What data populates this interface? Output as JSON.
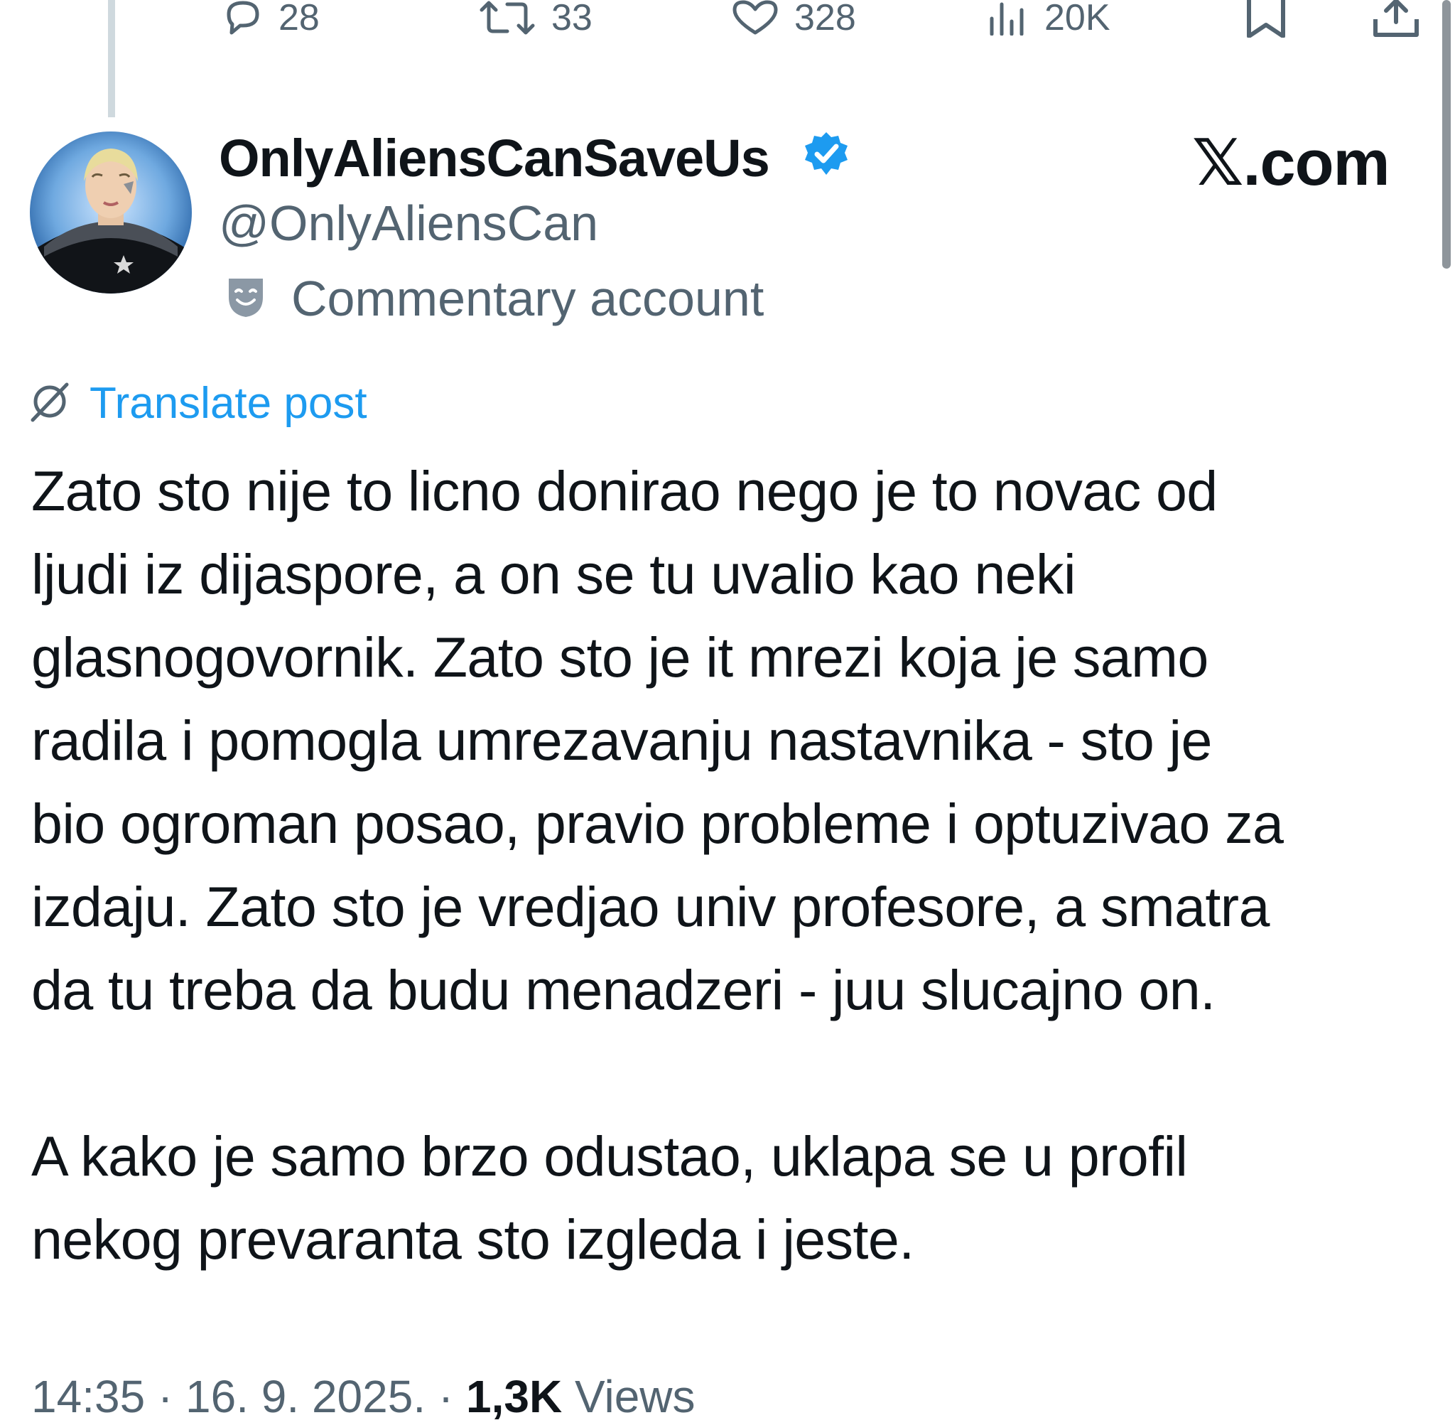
{
  "actions": {
    "reply": {
      "icon": "reply-icon",
      "count": "28"
    },
    "repost": {
      "icon": "repost-icon",
      "count": "33"
    },
    "like": {
      "icon": "heart-icon",
      "count": "328"
    },
    "views": {
      "icon": "views-chart-icon",
      "count": "20K"
    },
    "bookmark": {
      "icon": "bookmark-icon"
    },
    "share": {
      "icon": "share-icon"
    }
  },
  "author": {
    "display_name": "OnlyAliensCanSaveUs",
    "handle": "@OnlyAliensCan",
    "verified": true,
    "label": "Commentary account",
    "label_icon": "theater-masks-icon"
  },
  "brand": "𝕏.com",
  "translate": {
    "icon": "globe-icon",
    "text": "Translate post"
  },
  "post": {
    "paragraphs": [
      "Zato sto nije to licno donirao nego je to novac od\nljudi iz dijaspore, a on se tu uvalio kao neki\nglasnogovornik. Zato sto je it mrezi koja je samo\nradila i pomogla umrezavanju nastavnika - sto je\nbio ogroman posao, pravio probleme i optuzivao za\nizdaju. Zato sto je vredjao univ profesore, a smatra\nda tu treba da budu menadzeri - juu slucajno on.",
      "A kako je samo brzo odustao, uklapa se u profil\nnekog prevaranta sto izgleda i jeste."
    ]
  },
  "meta": {
    "time": "14:35",
    "date": "16. 9. 2025.",
    "views_count": "1,3K",
    "views_label": "Views"
  },
  "colors": {
    "text": "#0f1419",
    "secondary": "#536471",
    "accent": "#1d9bf0"
  }
}
